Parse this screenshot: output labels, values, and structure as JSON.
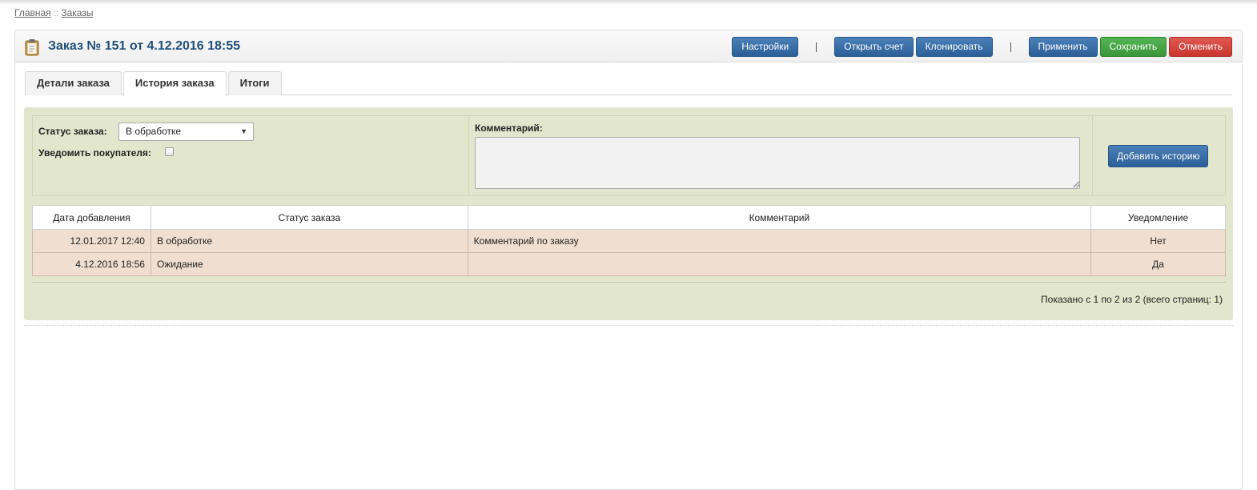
{
  "breadcrumb": {
    "home": "Главная",
    "separator": "::",
    "orders": "Заказы"
  },
  "header": {
    "title": "Заказ № 151 от 4.12.2016 18:55",
    "buttons": {
      "settings": "Настройки",
      "open_invoice": "Открыть счет",
      "clone": "Клонировать",
      "apply": "Применить",
      "save": "Сохранить",
      "cancel": "Отменить"
    },
    "separator": "|"
  },
  "tabs": [
    {
      "label": "Детали заказа",
      "active": false
    },
    {
      "label": "История заказа",
      "active": true
    },
    {
      "label": "Итоги",
      "active": false
    }
  ],
  "form": {
    "status_label": "Статус заказа:",
    "status_value": "В обработке",
    "notify_label": "Уведомить покупателя:",
    "notify_checked": false,
    "comment_label": "Комментарий:",
    "comment_value": "",
    "add_button": "Добавить историю"
  },
  "table": {
    "headers": [
      "Дата добавления",
      "Статус заказа",
      "Комментарий",
      "Уведомление"
    ],
    "rows": [
      [
        "12.01.2017 12:40",
        "В обработке",
        "Комментарий по заказу",
        "Нет"
      ],
      [
        "4.12.2016 18:56",
        "Ожидание",
        "",
        "Да"
      ]
    ]
  },
  "pagination": "Показано с 1 по 2 из 2 (всего страниц: 1)",
  "colors": {
    "accent": "#1f4e79",
    "panel_bg": "#e1e6cd",
    "row_bg": "#f0dfd0",
    "button_blue": "#2c5f97",
    "button_green": "#3a963a",
    "button_red": "#c9362e"
  },
  "icons": {
    "order": "clipboard-icon",
    "select_arrow": "chevron-down-icon"
  }
}
